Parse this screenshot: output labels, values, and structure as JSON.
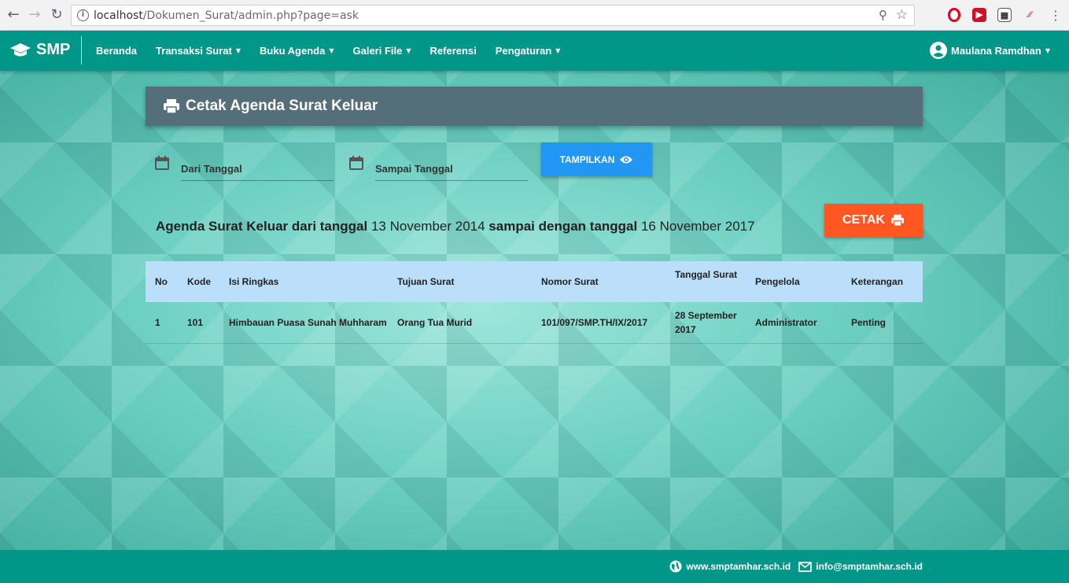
{
  "browser": {
    "url_host": "localhost",
    "url_path": "/Dokumen_Surat/admin.php?page=ask"
  },
  "nav": {
    "brand": "SMP",
    "items": [
      {
        "label": "Beranda",
        "caret": false
      },
      {
        "label": "Transaksi Surat",
        "caret": true
      },
      {
        "label": "Buku Agenda",
        "caret": true
      },
      {
        "label": "Galeri File",
        "caret": true
      },
      {
        "label": "Referensi",
        "caret": false
      },
      {
        "label": "Pengaturan",
        "caret": true
      }
    ],
    "user": "Maulana Ramdhan"
  },
  "page": {
    "title": "Cetak Agenda Surat Keluar",
    "from_placeholder": "Dari Tanggal",
    "to_placeholder": "Sampai Tanggal",
    "show_button": "TAMPILKAN",
    "print_button": "CETAK",
    "summary": {
      "prefix": "Agenda Surat Keluar dari tanggal",
      "from_date": "13 November 2014",
      "middle": "sampai dengan tanggal",
      "to_date": "16 November 2017"
    }
  },
  "table": {
    "headers": [
      "No",
      "Kode",
      "Isi Ringkas",
      "Tujuan Surat",
      "Nomor Surat",
      "Tanggal Surat",
      "Pengelola",
      "Keterangan"
    ],
    "rows": [
      [
        "1",
        "101",
        "Himbauan Puasa Sunah Muhharam",
        "Orang Tua Murid",
        "101/097/SMP.TH/IX/2017",
        "28 September 2017",
        "Administrator",
        "Penting"
      ]
    ]
  },
  "footer": {
    "website": "www.smptamhar.sch.id",
    "email": "info@smptamhar.sch.id"
  },
  "colors": {
    "primary": "#009688",
    "title_card": "#546e7a",
    "show_button": "#2196f3",
    "print_button": "#ff5722",
    "table_header": "#bbdefb"
  }
}
